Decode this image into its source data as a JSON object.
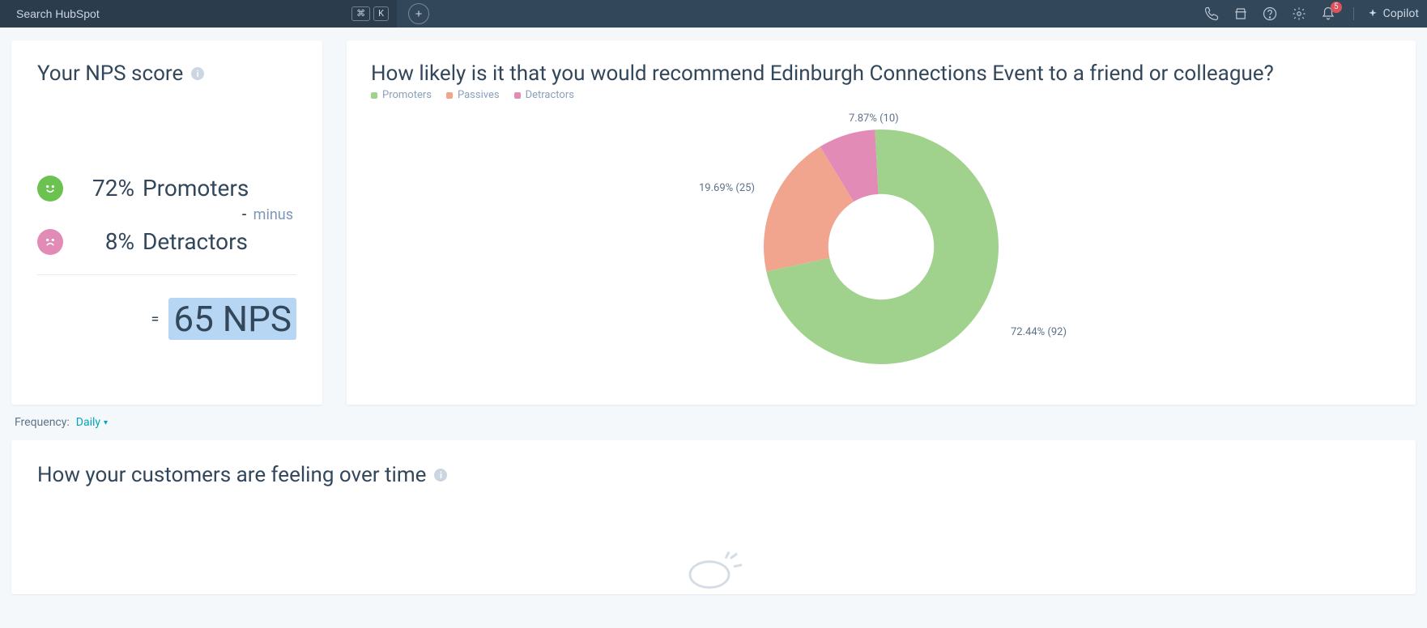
{
  "topbar": {
    "search_placeholder": "Search HubSpot",
    "kbd1": "⌘",
    "kbd2": "K",
    "plus_label": "+",
    "notification_count": "5",
    "copilot_label": "Copilot"
  },
  "nps_card": {
    "title": "Your NPS score",
    "promoters_pct": "72%",
    "promoters_label": "Promoters",
    "minus_sign": "-",
    "minus_word": "minus",
    "detractors_pct": "8%",
    "detractors_label": "Detractors",
    "equals": "=",
    "result": "65 NPS"
  },
  "chart_card": {
    "title": "How likely is it that you would recommend Edinburgh Connections Event to a friend or colleague?",
    "legend": {
      "promoters": "Promoters",
      "passives": "Passives",
      "detractors": "Detractors"
    },
    "labels": {
      "detractors": "7.87% (10)",
      "passives": "19.69% (25)",
      "promoters": "72.44% (92)"
    }
  },
  "frequency": {
    "label": "Frequency:",
    "value": "Daily"
  },
  "over_time": {
    "title": "How your customers are feeling over time"
  },
  "colors": {
    "promoters": "#a0d28e",
    "passives": "#f2a58e",
    "detractors": "#e18bb6"
  },
  "chart_data": {
    "type": "pie",
    "title": "How likely is it that you would recommend Edinburgh Connections Event to a friend or colleague?",
    "series": [
      {
        "name": "Promoters",
        "percent": 72.44,
        "count": 92,
        "color": "#a0d28e"
      },
      {
        "name": "Passives",
        "percent": 19.69,
        "count": 25,
        "color": "#f2a58e"
      },
      {
        "name": "Detractors",
        "percent": 7.87,
        "count": 10,
        "color": "#e18bb6"
      }
    ],
    "inner_radius_ratio": 0.45
  }
}
